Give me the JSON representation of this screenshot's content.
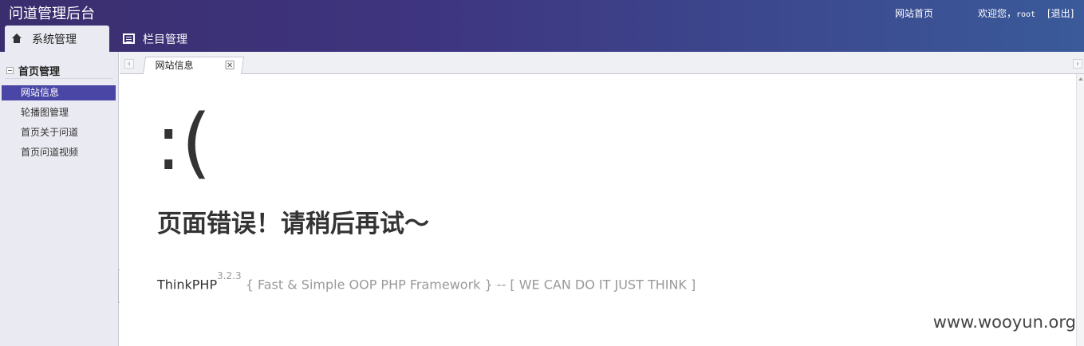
{
  "header": {
    "app_title": "问道管理后台",
    "home_link": "网站首页",
    "welcome_prefix": "欢迎您，",
    "username": "root",
    "logout": "[退出]"
  },
  "nav_tabs": [
    {
      "label": "系统管理",
      "icon": "home-icon",
      "active": true
    },
    {
      "label": "栏目管理",
      "icon": "list-icon",
      "active": false
    }
  ],
  "sidebar": {
    "group_title": "首页管理",
    "items": [
      {
        "label": "网站信息",
        "active": true
      },
      {
        "label": "轮播图管理",
        "active": false
      },
      {
        "label": "首页关于问道",
        "active": false
      },
      {
        "label": "首页问道视频",
        "active": false
      }
    ]
  },
  "content_tab": {
    "label": "网站信息"
  },
  "error_page": {
    "face": ":(",
    "message": "页面错误！请稍后再试～",
    "framework_name": "ThinkPHP",
    "framework_version": "3.2.3",
    "framework_tagline": " { Fast & Simple OOP PHP Framework } -- [ WE CAN DO IT JUST THINK ]"
  },
  "watermark": "www.wooyun.org",
  "colors": {
    "header_start": "#3b2e6e",
    "header_end": "#3a5a9a",
    "active_menu": "#4a46a6",
    "sidebar_bg": "#eaeaf2"
  }
}
